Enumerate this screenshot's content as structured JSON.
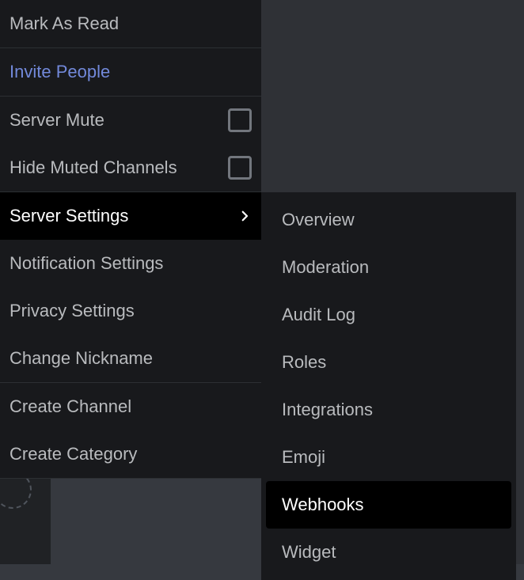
{
  "menu": {
    "mark_as_read": "Mark As Read",
    "invite_people": "Invite People",
    "server_mute": "Server Mute",
    "hide_muted_channels": "Hide Muted Channels",
    "server_settings": "Server Settings",
    "notification_settings": "Notification Settings",
    "privacy_settings": "Privacy Settings",
    "change_nickname": "Change Nickname",
    "create_channel": "Create Channel",
    "create_category": "Create Category"
  },
  "submenu": {
    "overview": "Overview",
    "moderation": "Moderation",
    "audit_log": "Audit Log",
    "roles": "Roles",
    "integrations": "Integrations",
    "emoji": "Emoji",
    "webhooks": "Webhooks",
    "widget": "Widget"
  }
}
